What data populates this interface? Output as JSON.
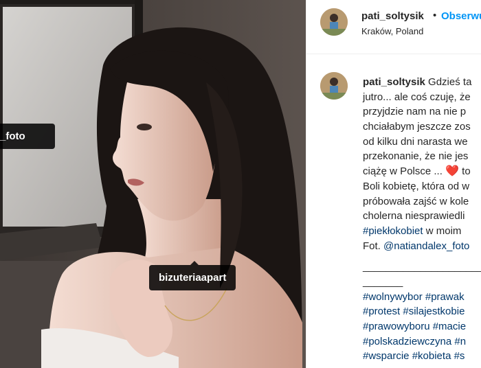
{
  "post": {
    "username": "pati_soltysik",
    "follow_label": "Obserwuj",
    "location": "Kraków, Poland",
    "photo_tags": [
      "_foto",
      "bizuteriaapart"
    ]
  },
  "caption": {
    "username": "pati_soltysik",
    "lines": [
      "Gdzieś ta",
      "jutro... ale coś czuję, że",
      "przyjdzie nam na nie p",
      "chciałabym jeszcze zos",
      "od kilku dni narasta we",
      "przekonanie, że nie jes",
      "ciążę w Polsce ...",
      "Boli kobietę, która od w",
      "próbowała zajść w kole",
      "cholerna niesprawiedli"
    ],
    "heart_after": "to",
    "hashtag_line": {
      "tag": "#piekłokobiet",
      "rest": " w moim"
    },
    "credit_line": {
      "prefix": "Fot. ",
      "mention": "@natiandalex_foto"
    },
    "divider_1": "______________________",
    "divider_2": "_______",
    "hashtag_rows": [
      "#wolnywybor #prawak",
      "#protest #silajestkobie",
      "#prawowyboru #macie",
      "#polskadziewczyna #n",
      "#wsparcie #kobieta #s"
    ]
  },
  "colors": {
    "link": "#00376b",
    "follow": "#0095f6",
    "heart": "#ed1c3a"
  }
}
